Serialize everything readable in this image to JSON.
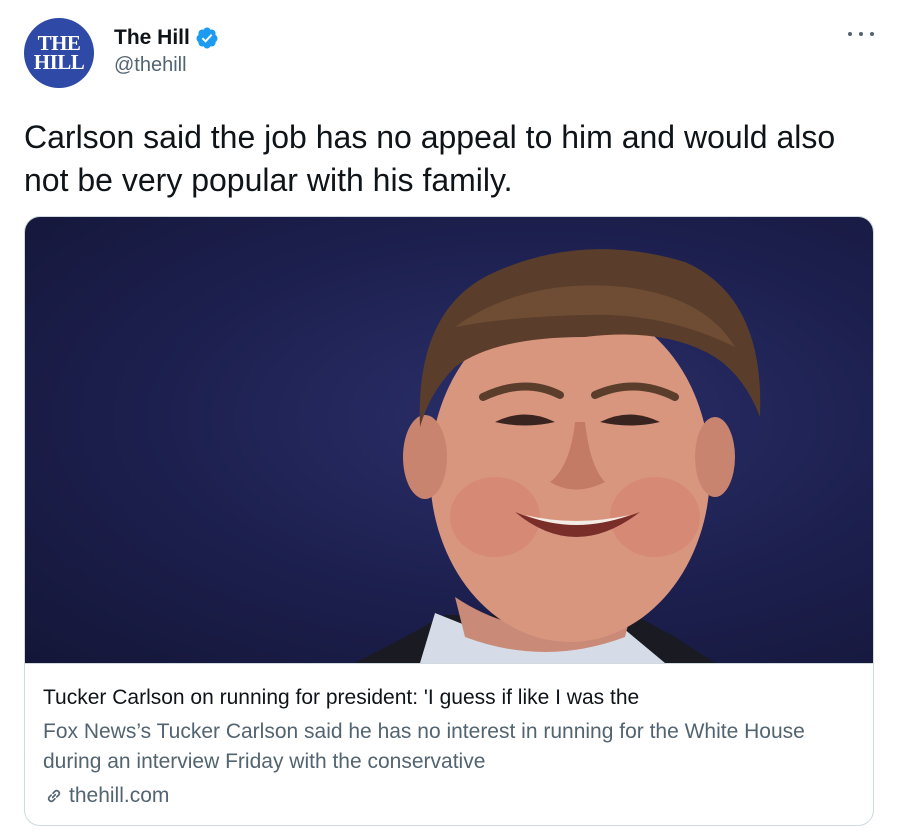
{
  "author": {
    "avatar_line1": "THE",
    "avatar_line2": "HILL",
    "display_name": "The Hill",
    "handle": "@thehill",
    "verified": true
  },
  "tweet": {
    "text": "Carlson said the job has no appeal to him and would also not be very popular with his family."
  },
  "card": {
    "title": "Tucker Carlson on running for president: 'I guess if like I was the",
    "description": "Fox News’s Tucker Carlson said he has no interest in running for the White House during an interview Friday with the conservative",
    "domain": "thehill.com"
  },
  "colors": {
    "brand_avatar": "#2e49a6",
    "verified_badge": "#1d9bf0",
    "secondary_text": "#536471",
    "primary_text": "#0f1419",
    "border": "#cfd9de"
  },
  "icons": {
    "verified": "verified-badge-icon",
    "more": "more-options-icon",
    "link": "link-icon"
  }
}
